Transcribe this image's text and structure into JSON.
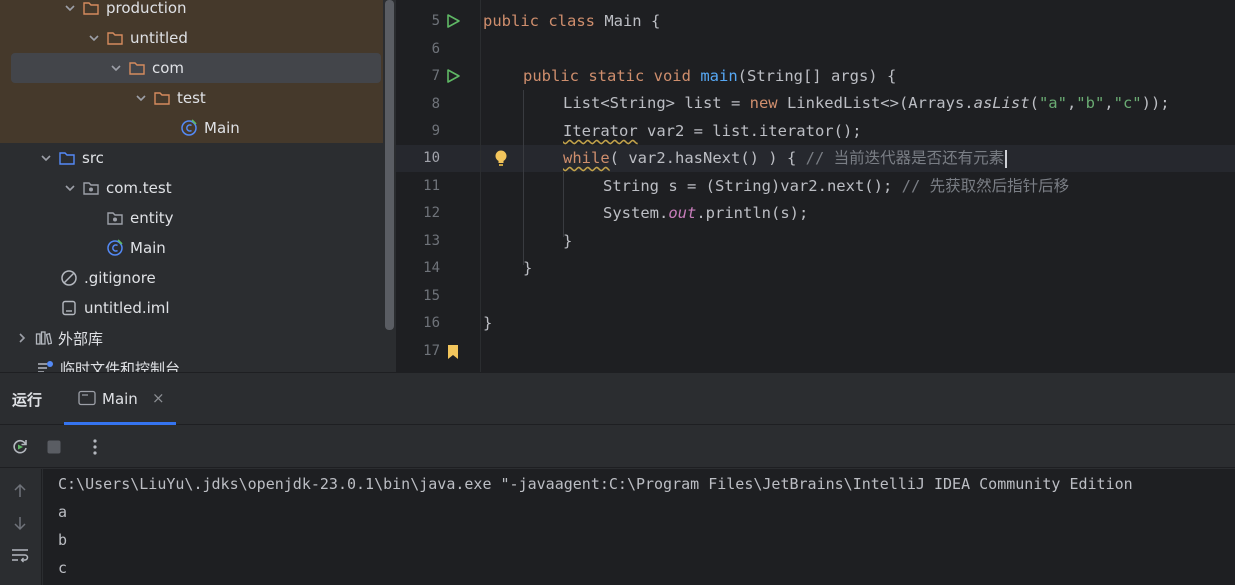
{
  "project_tree": {
    "items": [
      {
        "label": "production",
        "icon": "folder-excluded-icon"
      },
      {
        "label": "untitled",
        "icon": "folder-excluded-icon"
      },
      {
        "label": "com",
        "icon": "folder-excluded-icon"
      },
      {
        "label": "test",
        "icon": "folder-excluded-icon"
      },
      {
        "label": "Main",
        "icon": "java-class-icon"
      },
      {
        "label": "src",
        "icon": "source-folder-icon"
      },
      {
        "label": "com.test",
        "icon": "package-icon"
      },
      {
        "label": "entity",
        "icon": "package-icon"
      },
      {
        "label": "Main",
        "icon": "java-class-icon"
      },
      {
        "label": ".gitignore",
        "icon": "ignore-file-icon"
      },
      {
        "label": "untitled.iml",
        "icon": "module-file-icon"
      },
      {
        "label": "外部库",
        "icon": "library-icon"
      },
      {
        "label": "临时文件和控制台",
        "icon": "scratches-icon"
      }
    ]
  },
  "editor": {
    "line_numbers": [
      "5",
      "6",
      "7",
      "8",
      "9",
      "10",
      "11",
      "12",
      "13",
      "14",
      "15",
      "16",
      "17"
    ],
    "current_line": "10",
    "code": {
      "l5": {
        "kw1": "public class",
        "rest": " Main {"
      },
      "l7": {
        "kw1": "public static void",
        "fn": "main",
        "rest": "(String[] args) {"
      },
      "l8": {
        "p1": "List<String> list = ",
        "kw": "new",
        "p2": " LinkedList<>(Arrays.",
        "it": "asList",
        "p3": "(",
        "s1": "\"a\"",
        "c1": ",",
        "s2": "\"b\"",
        "c2": ",",
        "s3": "\"c\"",
        "p4": "));"
      },
      "l9": {
        "warn": "Iterator",
        "rest": " var2 = list.iterator();"
      },
      "l10": {
        "kw": "while",
        "rest": "( var2.hasNext() ) { ",
        "comment": "// 当前迭代器是否还有元素"
      },
      "l11": {
        "rest": "String s = (String)var2.next(); ",
        "comment": "// 先获取然后指针后移"
      },
      "l12": {
        "p1": "System.",
        "field": "out",
        "p2": ".println(s);"
      },
      "l13": {
        "rest": "}"
      },
      "l14": {
        "rest": "}"
      },
      "l16": {
        "rest": "}"
      }
    }
  },
  "run_window": {
    "title": "运行",
    "tab_label": "Main",
    "tab_close": "×",
    "console_lines": [
      "C:\\Users\\LiuYu\\.jdks\\openjdk-23.0.1\\bin\\java.exe \"-javaagent:C:\\Program Files\\JetBrains\\IntelliJ IDEA Community Edition",
      "a",
      "b",
      "c"
    ]
  },
  "colors": {
    "accent": "#3574f0",
    "keyword": "#cf8e6d",
    "method": "#56a8f5",
    "string": "#6aab73",
    "comment": "#7a7e85",
    "excluded_folder": "#45392b"
  }
}
